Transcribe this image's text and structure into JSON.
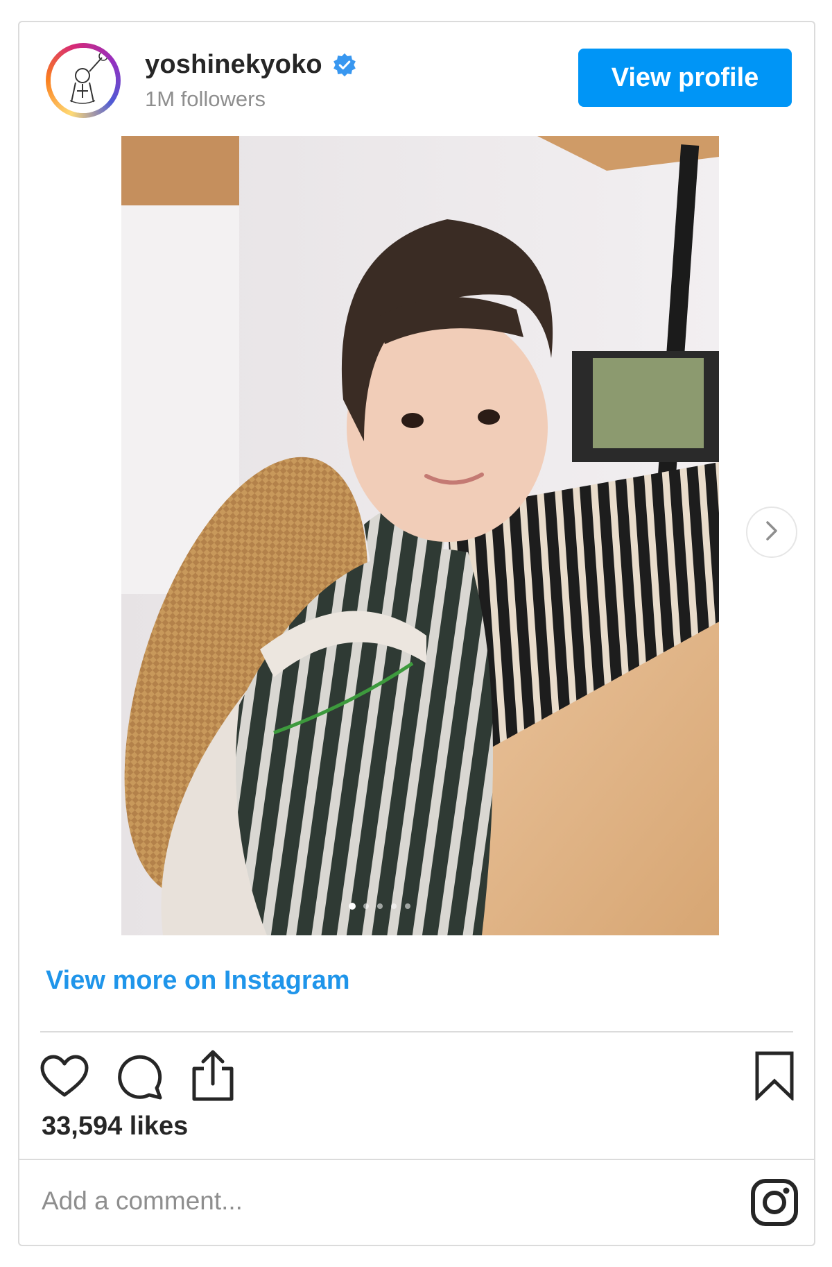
{
  "profile": {
    "username": "yoshinekyoko",
    "verified": true,
    "followers": "1M followers",
    "view_profile_label": "View profile"
  },
  "post": {
    "image_semantic": "photo of a woman with short hair wearing a striped top and straw hat on her back",
    "carousel_dots": 5,
    "carousel_active_index": 0,
    "view_more_label": "View more on Instagram",
    "likes": "33,594 likes",
    "comment_placeholder": "Add a comment..."
  },
  "icons": [
    "heart-icon",
    "comment-icon",
    "share-icon",
    "bookmark-icon",
    "instagram-logo-icon",
    "verified-icon",
    "chevron-right-icon"
  ],
  "colors": {
    "accent": "#0095f6",
    "link": "#1f95ea",
    "verified": "#3897f0",
    "muted": "#8e8e8e",
    "text": "#262626"
  }
}
